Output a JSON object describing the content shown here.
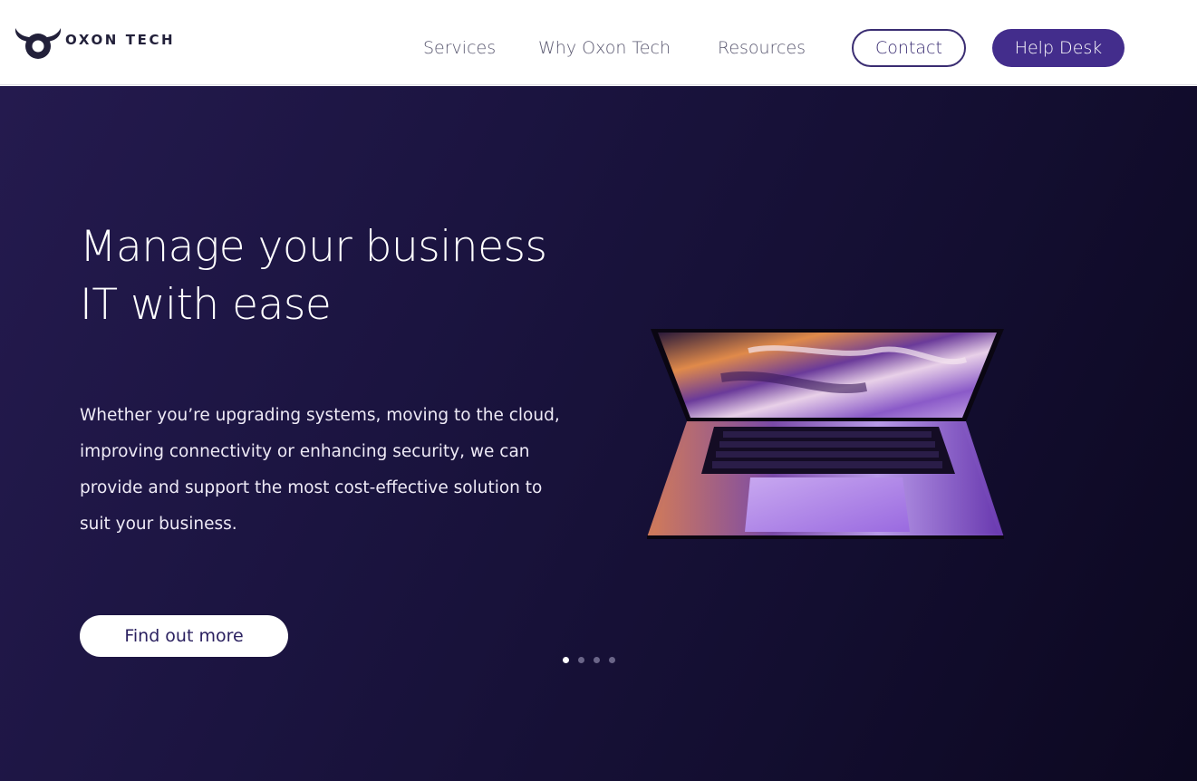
{
  "brand": {
    "name": "OXON TECH",
    "logo_icon": "bull-horns-icon"
  },
  "nav": {
    "items": [
      {
        "label": "Services"
      },
      {
        "label": "Why Oxon Tech"
      },
      {
        "label": "Resources"
      }
    ],
    "contact_label": "Contact",
    "helpdesk_label": "Help Desk"
  },
  "hero": {
    "title_line1": "Manage your business",
    "title_line2": "IT with ease",
    "body": "Whether you’re upgrading systems, moving to the cloud, improving connectivity or enhancing security, we can provide and support the most cost-effective solution to suit your business.",
    "cta_label": "Find out more",
    "image": "laptop-image",
    "slides": {
      "count": 4,
      "active": 1
    }
  },
  "colors": {
    "accent": "#432d8c",
    "accent_dark": "#3a2d72",
    "hero_bg": "#1b1440",
    "text_dark": "#22203a"
  }
}
